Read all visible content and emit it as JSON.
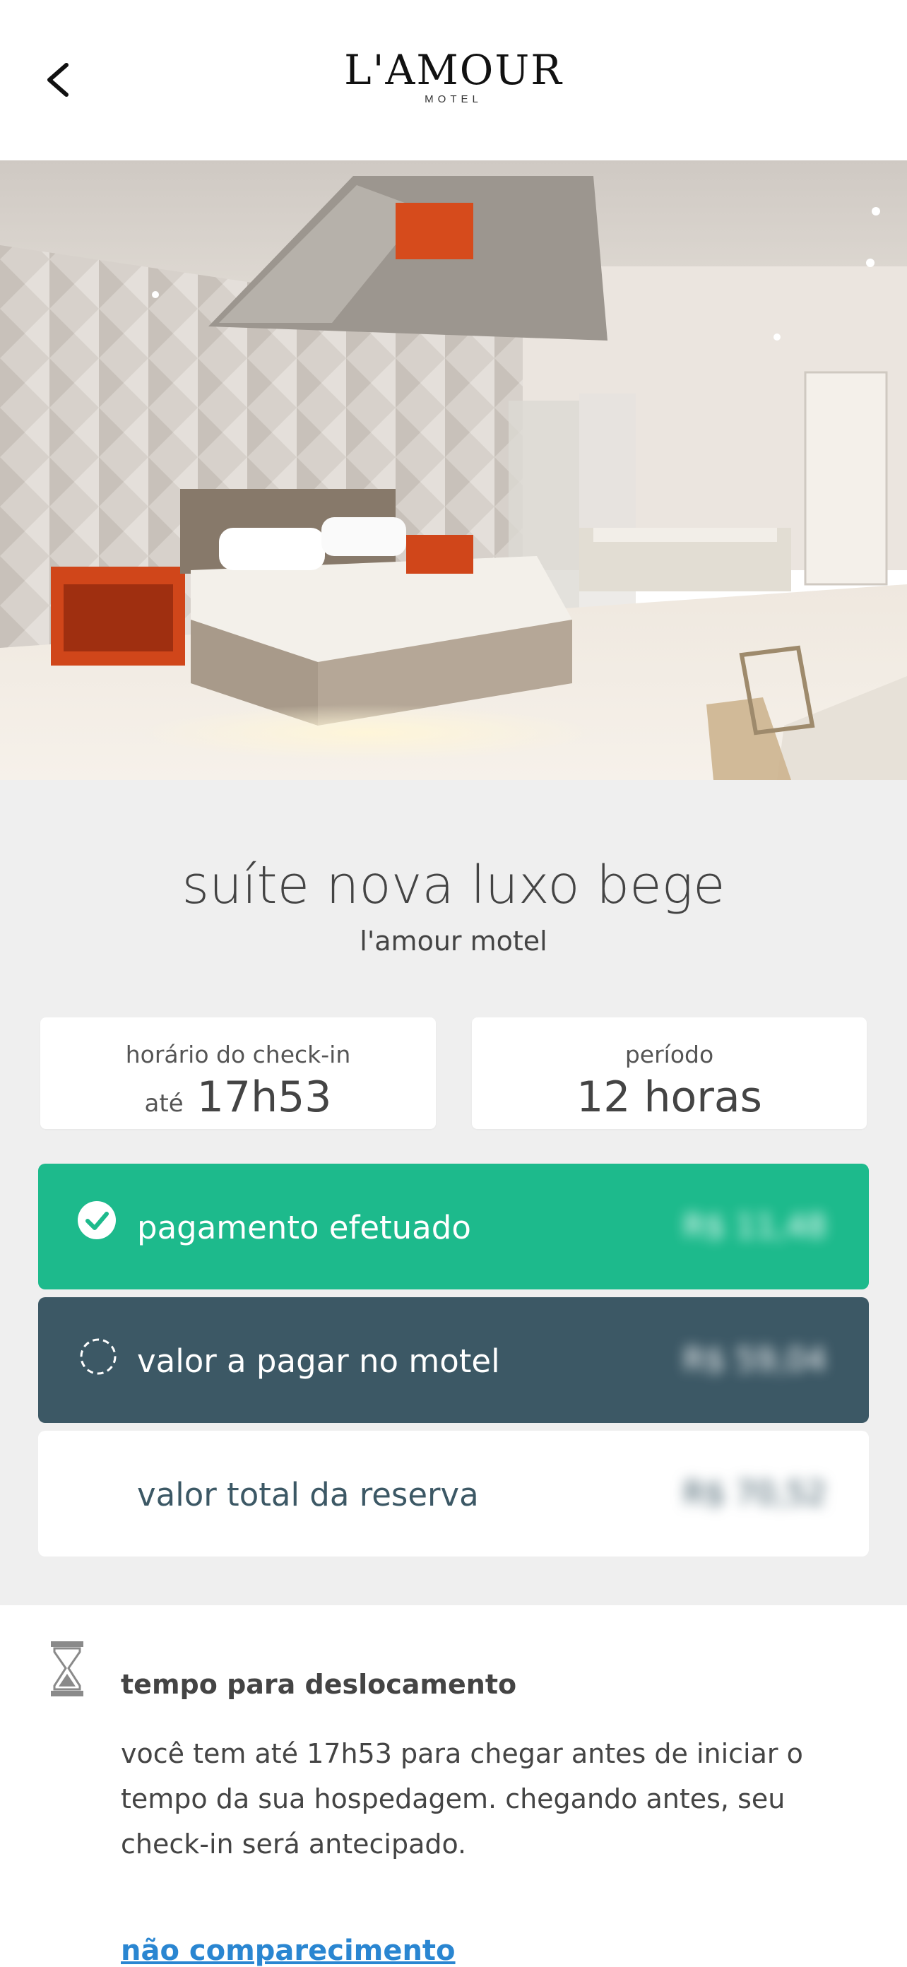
{
  "header": {
    "back_icon": "chevron-left-icon",
    "logo_main": "L'AMOUR",
    "logo_sub": "MOTEL"
  },
  "suite": {
    "name": "suíte nova luxo bege",
    "motel": "l'amour motel"
  },
  "checkin": {
    "label": "horário do check-in",
    "prefix": "até",
    "time": "17h53"
  },
  "periodo": {
    "label": "período",
    "value": "12 horas"
  },
  "payments": [
    {
      "label": "pagamento efetuado",
      "amount": "R$ 11,48",
      "icon": "check-circle-icon",
      "bg": "#1dba8c",
      "color": "#ffffff"
    },
    {
      "label": "valor a pagar no motel",
      "amount": "R$ 59,04",
      "icon": "dashed-circle-icon",
      "bg": "#3c5865",
      "color": "#ffffff"
    },
    {
      "label": "valor total da reserva",
      "amount": "R$ 70,52",
      "icon": "",
      "bg": "#ffffff",
      "color": "#3c5865"
    }
  ],
  "tempo": {
    "icon": "hourglass-icon",
    "title": "tempo para deslocamento",
    "text": "você tem até 17h53 para chegar antes de iniciar o tempo da sua hospedagem. chegando antes, seu check-in será antecipado."
  },
  "link": "não comparecimento",
  "colors": {
    "green": "#1dba8c",
    "slate": "#3c5865",
    "link": "#2a86d1",
    "gray_bg": "#efefef"
  }
}
